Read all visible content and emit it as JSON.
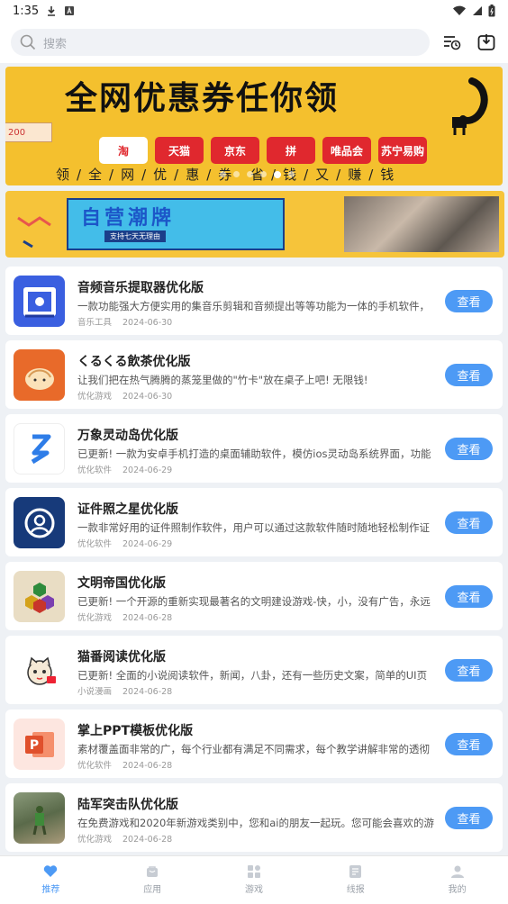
{
  "status_bar": {
    "time": "1:35"
  },
  "search": {
    "placeholder": "搜索"
  },
  "banner1": {
    "title": "全网优惠券任你领",
    "ticket": "200",
    "logos": [
      "淘",
      "天猫",
      "京东",
      "拼",
      "唯品会",
      "苏宁易购"
    ],
    "slogan": "领/全/网/优/惠/券 省/钱/又/赚/钱"
  },
  "banner2": {
    "title": "自营潮牌",
    "subtitle": "支持七天无理由"
  },
  "apps": [
    {
      "title": "音频音乐提取器优化版",
      "desc": "一款功能强大方便实用的集音乐剪辑和音频提出等等功能为一体的手机软件，",
      "category": "音乐工具",
      "date": "2024-06-30",
      "button": "查看"
    },
    {
      "title": "くるくる飲茶优化版",
      "desc": "让我们把在热气腾腾的蒸笼里做的\"竹卡\"放在桌子上吧! 无限钱!",
      "category": "优化游戏",
      "date": "2024-06-30",
      "button": "查看"
    },
    {
      "title": "万象灵动岛优化版",
      "desc": "已更新! 一款为安卓手机打造的桌面辅助软件，模仿ios灵动岛系统界面，功能",
      "category": "优化软件",
      "date": "2024-06-29",
      "button": "查看"
    },
    {
      "title": "证件照之星优化版",
      "desc": "一款非常好用的证件照制作软件，用户可以通过这款软件随时随地轻松制作证",
      "category": "优化软件",
      "date": "2024-06-29",
      "button": "查看"
    },
    {
      "title": "文明帝国优化版",
      "desc": "已更新! 一个开源的重新实现最著名的文明建设游戏-快，小，没有广告，永远",
      "category": "优化游戏",
      "date": "2024-06-28",
      "button": "查看"
    },
    {
      "title": "猫番阅读优化版",
      "desc": "已更新! 全面的小说阅读软件，新闻，八卦，还有一些历史文案，简单的UI页",
      "category": "小说漫画",
      "date": "2024-06-28",
      "button": "查看"
    },
    {
      "title": "掌上PPT模板优化版",
      "desc": "素材覆盖面非常的广，每个行业都有满足不同需求，每个教学讲解非常的透彻",
      "category": "优化软件",
      "date": "2024-06-28",
      "button": "查看"
    },
    {
      "title": "陆军突击队优化版",
      "desc": "在免费游戏和2020年新游戏类别中，您和ai的朋友一起玩。您可能会喜欢的游",
      "category": "优化游戏",
      "date": "2024-06-28",
      "button": "查看"
    }
  ],
  "tabs": [
    {
      "label": "推荐",
      "icon": "heart-icon"
    },
    {
      "label": "应用",
      "icon": "bag-icon"
    },
    {
      "label": "游戏",
      "icon": "grid-icon"
    },
    {
      "label": "线报",
      "icon": "document-icon"
    },
    {
      "label": "我的",
      "icon": "user-icon"
    }
  ],
  "colors": {
    "accent": "#4d9af5",
    "banner_yellow": "#f4c02e",
    "background": "#eef1f5"
  }
}
